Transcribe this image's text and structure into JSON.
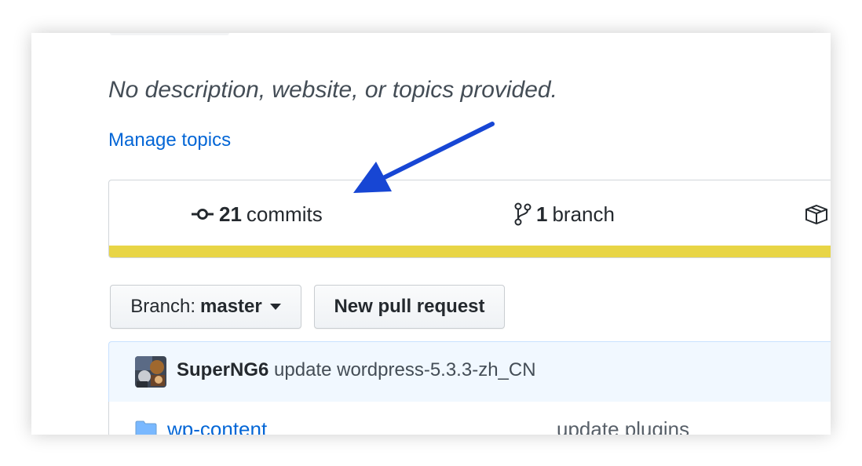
{
  "repo": {
    "description": "No description, website, or topics provided.",
    "manage_topics_label": "Manage topics"
  },
  "summary": {
    "commits": {
      "count": "21",
      "label": "commits",
      "icon": "commit-icon"
    },
    "branches": {
      "count": "1",
      "label": "branch",
      "icon": "branch-icon"
    },
    "releases": {
      "icon": "package-icon"
    },
    "language_bar_color": "#e8d546"
  },
  "toolbar": {
    "branch_prefix": "Branch:",
    "branch_name": "master",
    "new_pr_label": "New pull request"
  },
  "latest_commit": {
    "author": "SuperNG6",
    "message": "update wordpress-5.3.3-zh_CN"
  },
  "files": [
    {
      "icon": "folder-icon",
      "name": "wp-content",
      "message": "update plugins"
    }
  ],
  "annotation": {
    "arrow_color": "#1746d4"
  },
  "colors": {
    "link": "#0366d6",
    "text": "#24292e",
    "muted": "#444d56"
  }
}
